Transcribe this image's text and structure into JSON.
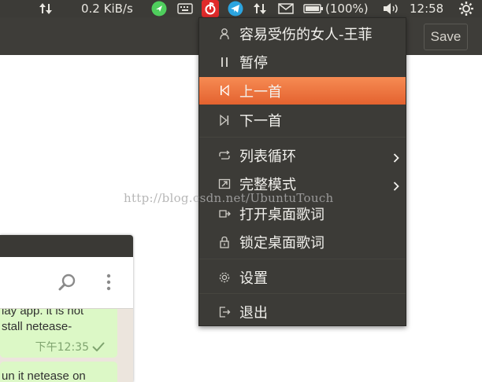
{
  "panel": {
    "network_speed": "0.2 KiB/s",
    "battery": "(100%)",
    "clock": "12:58"
  },
  "app": {
    "save_label": "Save"
  },
  "menu": {
    "items": [
      {
        "label": "容易受伤的女人-王菲",
        "icon": "user-icon"
      },
      {
        "label": "暂停",
        "icon": "pause-icon"
      },
      {
        "label": "上一首",
        "icon": "skip-previous-icon",
        "active": true
      },
      {
        "label": "下一首",
        "icon": "skip-next-icon"
      },
      {
        "label": "列表循环",
        "icon": "repeat-icon",
        "submenu": true
      },
      {
        "label": "完整模式",
        "icon": "expand-icon",
        "submenu": true
      },
      {
        "label": "打开桌面歌词",
        "icon": "lyrics-icon"
      },
      {
        "label": "锁定桌面歌词",
        "icon": "lock-icon"
      },
      {
        "label": "设置",
        "icon": "gear-icon"
      },
      {
        "label": "退出",
        "icon": "exit-icon"
      }
    ]
  },
  "chat": {
    "message_1_line_1": "lay app. it is not",
    "message_1_line_2": "stall netease-",
    "message_1_time": "下午12:35",
    "message_2_line_1": "un it netease on"
  },
  "watermark": "http://blog.csdn.net/UbuntuTouch",
  "colors": {
    "panel_bg": "#3c3b37",
    "menu_highlight": "#f07640",
    "chat_bubble": "#dcf8c6",
    "netease_red": "#e02a2a",
    "telegram_blue": "#2ca5e0",
    "whatsapp_green": "#4fce5d"
  }
}
